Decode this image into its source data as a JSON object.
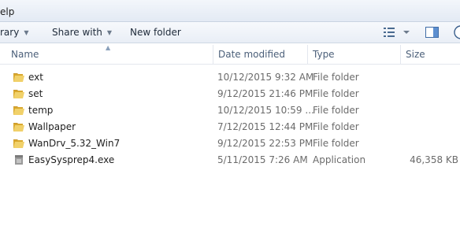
{
  "menubar": {
    "help_label": "elp"
  },
  "toolbar": {
    "library_label": "rary",
    "share_label": "Share with",
    "newfolder_label": "New folder",
    "caret": "▼"
  },
  "columns": {
    "name": "Name",
    "date": "Date modified",
    "type": "Type",
    "size": "Size"
  },
  "files": [
    {
      "name": "ext",
      "date": "10/12/2015 9:32 AM",
      "type": "File folder",
      "size": "",
      "icon": "folder-icon"
    },
    {
      "name": "set",
      "date": "9/12/2015 21:46 PM",
      "type": "File folder",
      "size": "",
      "icon": "folder-icon"
    },
    {
      "name": "temp",
      "date": "10/12/2015 10:59 ...",
      "type": "File folder",
      "size": "",
      "icon": "folder-icon"
    },
    {
      "name": "Wallpaper",
      "date": "7/12/2015 12:44 PM",
      "type": "File folder",
      "size": "",
      "icon": "folder-icon"
    },
    {
      "name": "WanDrv_5.32_Win7",
      "date": "9/12/2015 22:53 PM",
      "type": "File folder",
      "size": "",
      "icon": "folder-icon"
    },
    {
      "name": "EasySysprep4.exe",
      "date": "5/11/2015 7:26 AM",
      "type": "Application",
      "size": "46,358 KB",
      "icon": "application-icon"
    }
  ],
  "colors": {
    "folder": "#e8c04a",
    "header_text": "#4c607a",
    "meta_text": "#6b6b6b"
  }
}
